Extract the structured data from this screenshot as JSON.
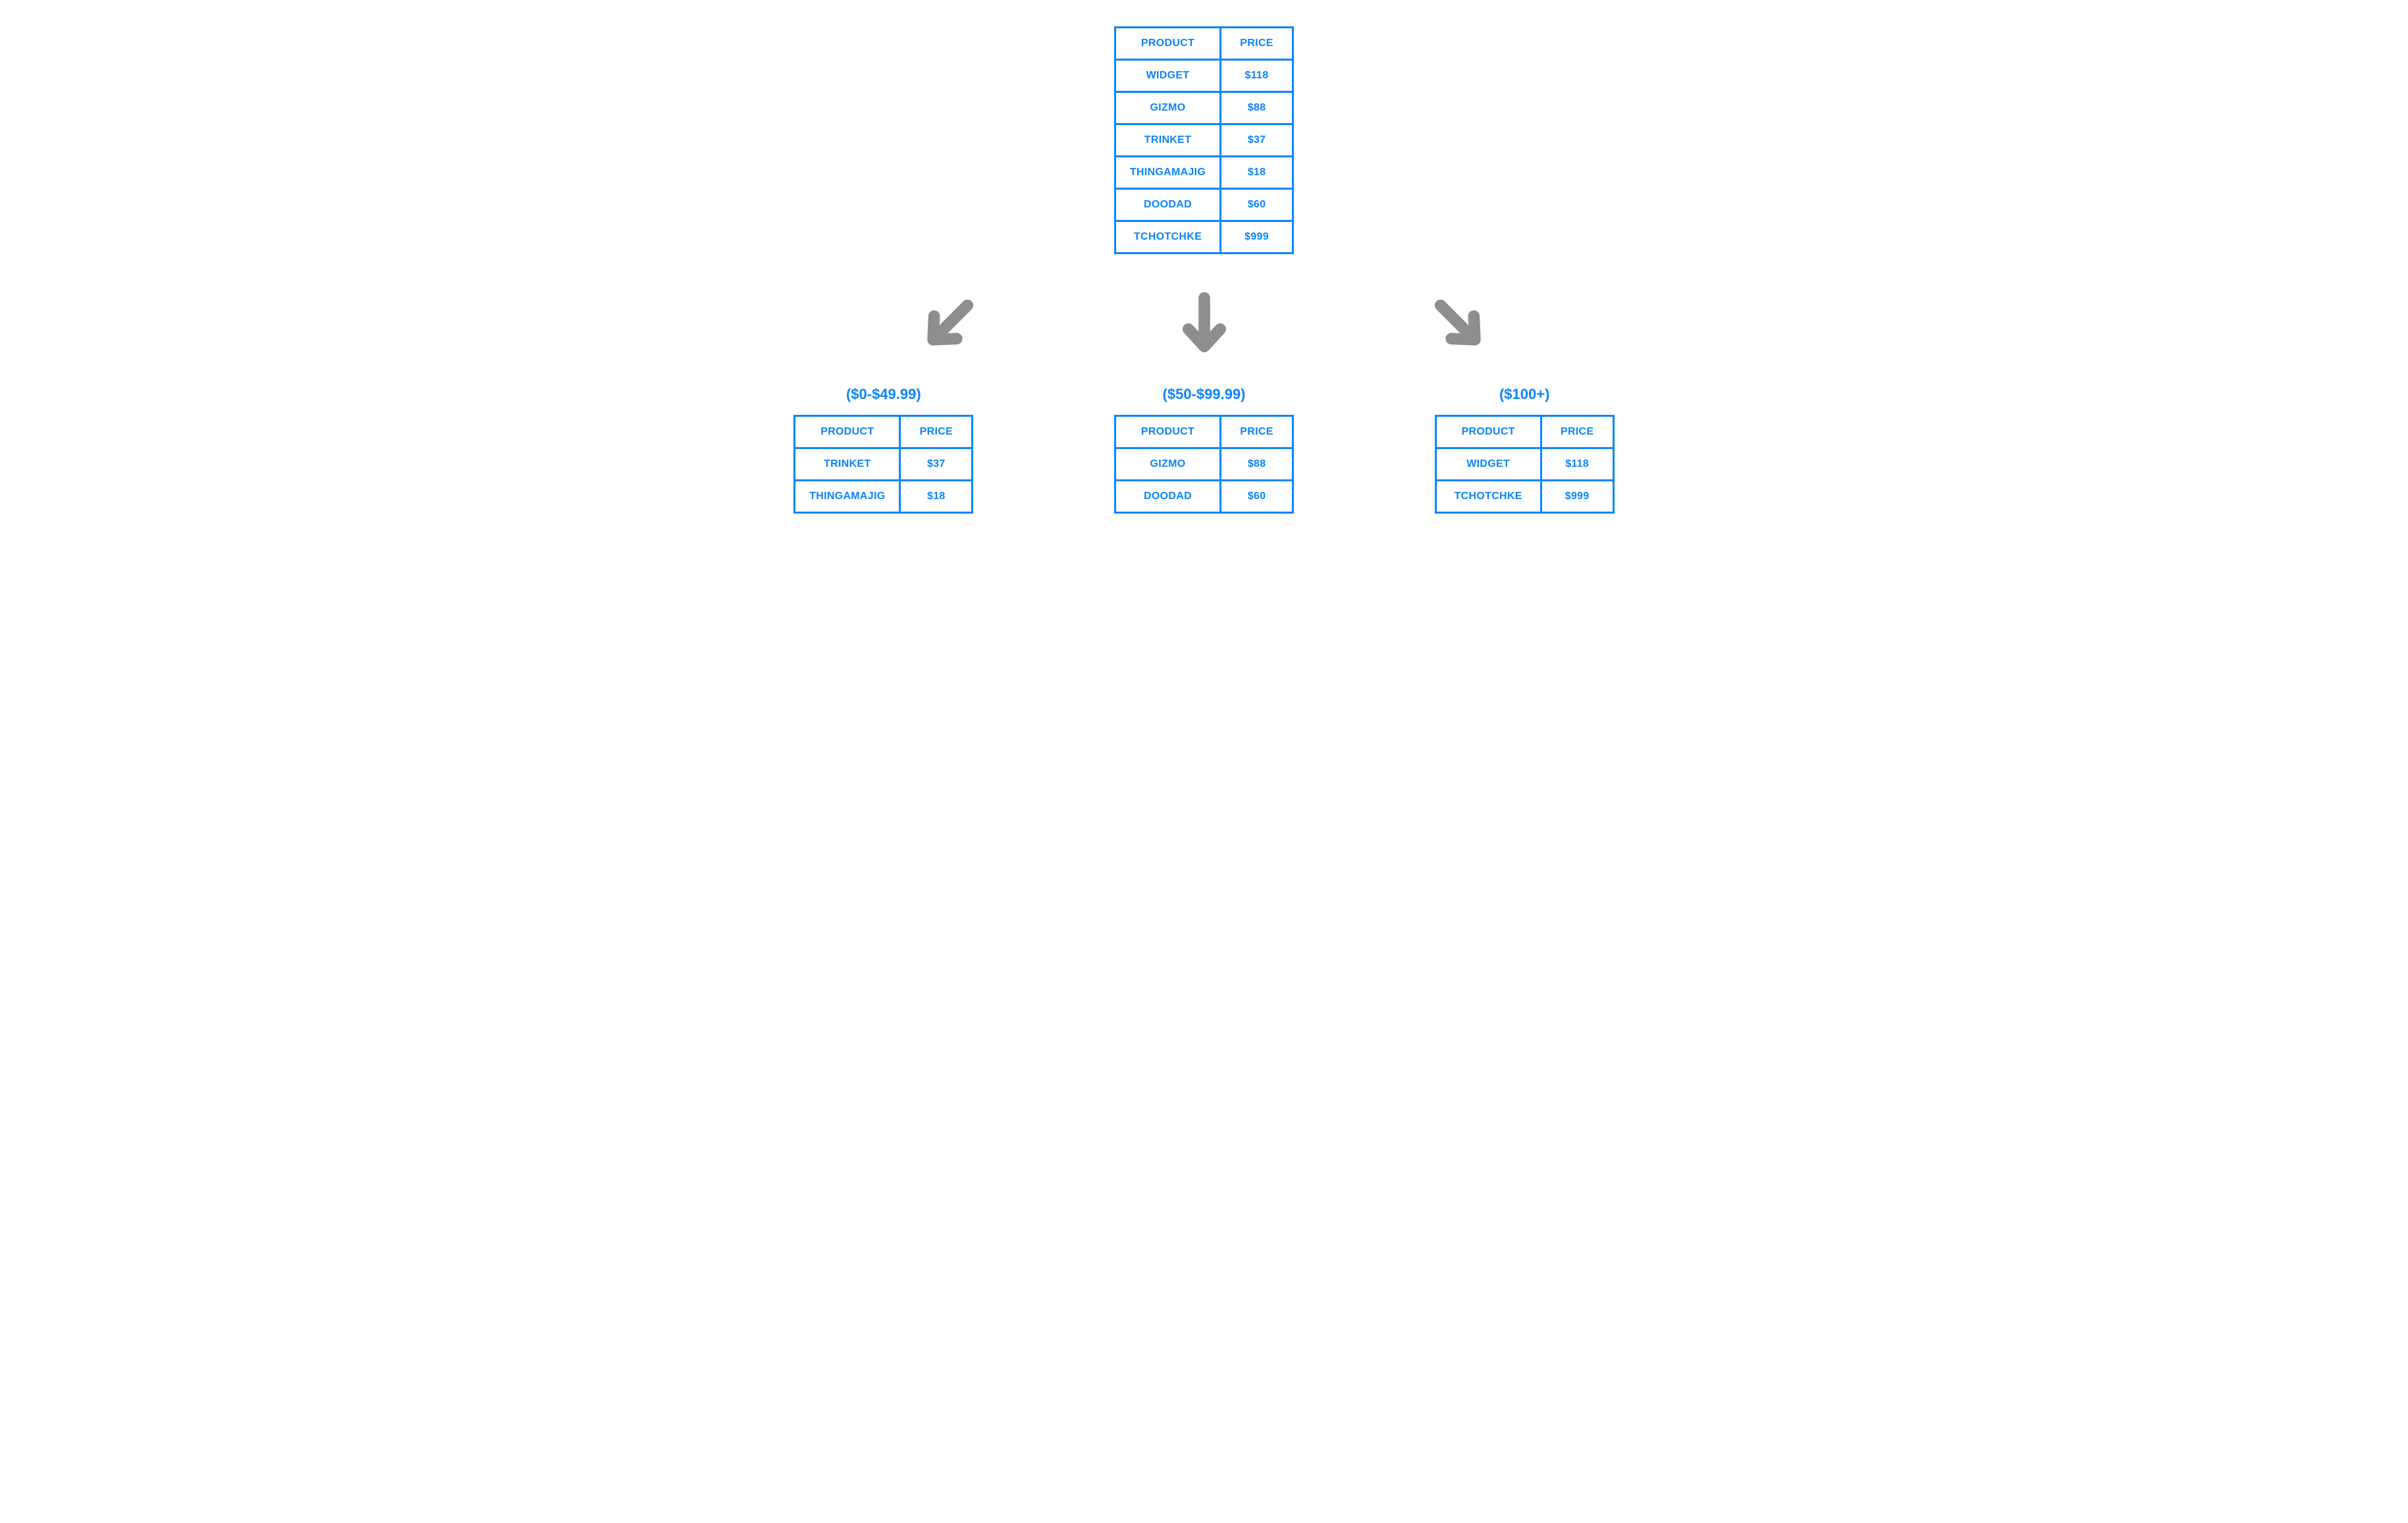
{
  "colors": {
    "primary": "#0a84ff",
    "arrow": "#8e8e8e"
  },
  "source_table": {
    "headers": {
      "product": "PRODUCT",
      "price": "PRICE"
    },
    "rows": [
      {
        "product": "WIDGET",
        "price": "$118"
      },
      {
        "product": "GIZMO",
        "price": "$88"
      },
      {
        "product": "TRINKET",
        "price": "$37"
      },
      {
        "product": "THINGAMAJIG",
        "price": "$18"
      },
      {
        "product": "DOODAD",
        "price": "$60"
      },
      {
        "product": "TCHOTCHKE",
        "price": "$999"
      }
    ]
  },
  "buckets": [
    {
      "label": "($0-$49.99)",
      "headers": {
        "product": "PRODUCT",
        "price": "PRICE"
      },
      "rows": [
        {
          "product": "TRINKET",
          "price": "$37"
        },
        {
          "product": "THINGAMAJIG",
          "price": "$18"
        }
      ]
    },
    {
      "label": "($50-$99.99)",
      "headers": {
        "product": "PRODUCT",
        "price": "PRICE"
      },
      "rows": [
        {
          "product": "GIZMO",
          "price": "$88"
        },
        {
          "product": "DOODAD",
          "price": "$60"
        }
      ]
    },
    {
      "label": "($100+)",
      "headers": {
        "product": "PRODUCT",
        "price": "PRICE"
      },
      "rows": [
        {
          "product": "WIDGET",
          "price": "$118"
        },
        {
          "product": "TCHOTCHKE",
          "price": "$999"
        }
      ]
    }
  ]
}
